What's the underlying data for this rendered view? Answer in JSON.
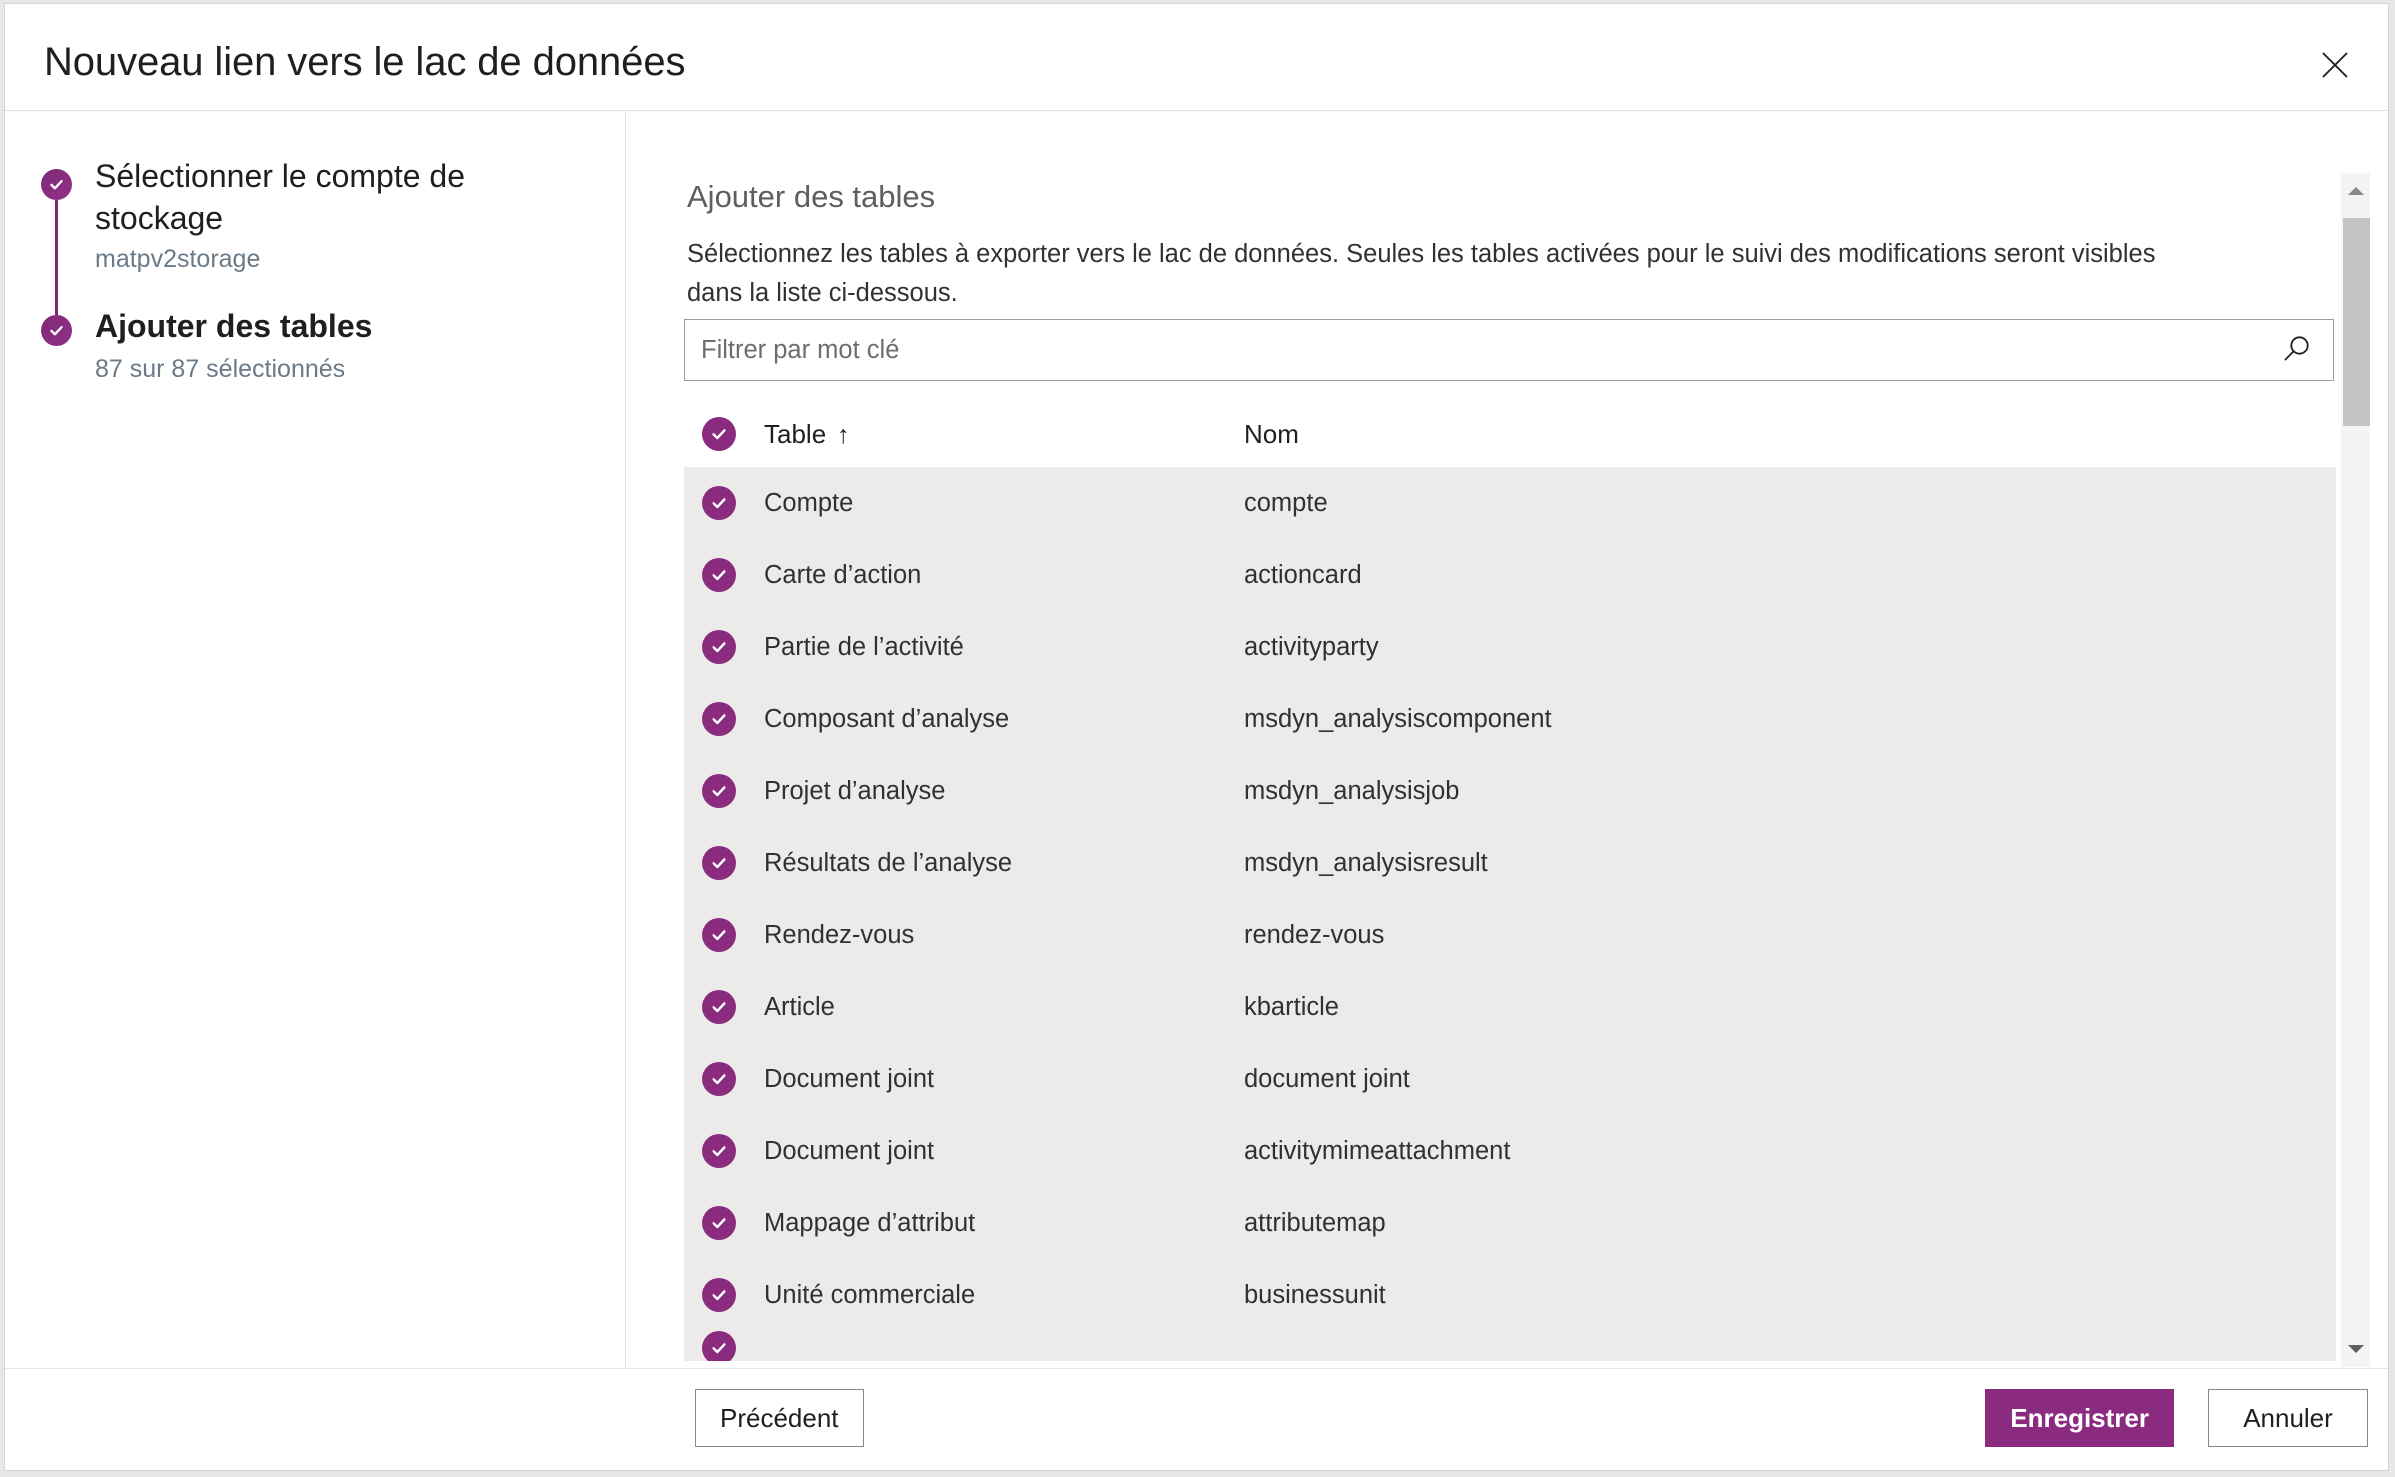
{
  "dialog": {
    "title": "Nouveau lien vers le lac de données",
    "close_label": "Fermer"
  },
  "sidebar": {
    "steps": [
      {
        "title": "Sélectionner le compte de stockage",
        "subtitle": "matpv2storage",
        "state": "completed"
      },
      {
        "title": "Ajouter des tables",
        "subtitle": "87 sur 87 sélectionnés",
        "state": "current"
      }
    ]
  },
  "main": {
    "section_title": "Ajouter des tables",
    "description": "Sélectionnez les tables à exporter vers le lac de données. Seules les tables activées pour le suivi des modifications seront visibles dans la liste ci-dessous.",
    "search": {
      "placeholder": "Filtrer par mot clé",
      "value": "",
      "icon": "search-icon"
    },
    "table": {
      "columns": [
        {
          "key": "table",
          "label": "Table",
          "sort": "↑"
        },
        {
          "key": "nom",
          "label": "Nom",
          "sort": ""
        }
      ],
      "select_all_checked": true,
      "rows": [
        {
          "table": "Compte",
          "nom": "compte",
          "checked": true
        },
        {
          "table": "Carte d’action",
          "nom": "actioncard",
          "checked": true
        },
        {
          "table": "Partie de l’activité",
          "nom": "activityparty",
          "checked": true
        },
        {
          "table": "Composant d’analyse",
          "nom": "msdyn_analysiscomponent",
          "checked": true
        },
        {
          "table": "Projet d’analyse",
          "nom": "msdyn_analysisjob",
          "checked": true
        },
        {
          "table": "Résultats de l’analyse",
          "nom": "msdyn_analysisresult",
          "checked": true
        },
        {
          "table": "Rendez-vous",
          "nom": "rendez-vous",
          "checked": true
        },
        {
          "table": "Article",
          "nom": "kbarticle",
          "checked": true
        },
        {
          "table": "Document joint",
          "nom": "document joint",
          "checked": true
        },
        {
          "table": "Document joint",
          "nom": "activitymimeattachment",
          "checked": true
        },
        {
          "table": "Mappage d’attribut",
          "nom": "attributemap",
          "checked": true
        },
        {
          "table": "Unité commerciale",
          "nom": "businessunit",
          "checked": true
        }
      ]
    },
    "scrollbar": {
      "up_icon": "caret-up-icon",
      "down_icon": "caret-down-icon",
      "thumb_position_percent": 4
    }
  },
  "footer": {
    "previous_label": "Précédent",
    "save_label": "Enregistrer",
    "cancel_label": "Annuler"
  },
  "colors": {
    "accent": "#8b2b80",
    "row_background": "#edebe9",
    "text_primary": "#323130",
    "text_muted": "#605e5c",
    "link_muted": "#6b7a86"
  }
}
